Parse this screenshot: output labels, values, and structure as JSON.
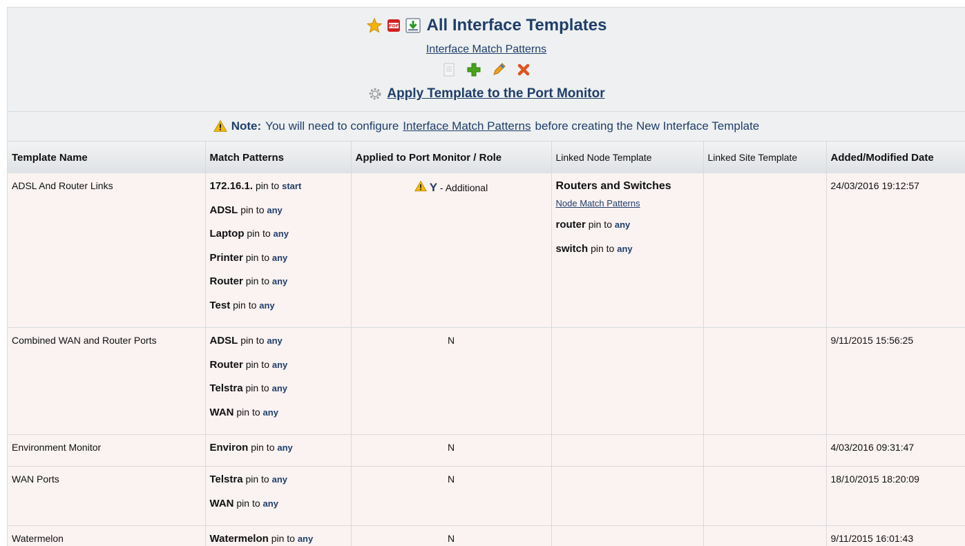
{
  "header": {
    "title": "All Interface Templates",
    "subtitle_link": "Interface Match Patterns",
    "apply_link": "Apply Template to the Port Monitor",
    "icons": [
      "star-icon",
      "pdf-icon",
      "download-icon"
    ],
    "tools": [
      "details-icon",
      "add-icon",
      "edit-icon",
      "delete-icon"
    ]
  },
  "note": {
    "label": "Note:",
    "text_before": "You will need to configure",
    "link": "Interface Match Patterns",
    "text_after": "before creating the New Interface Template"
  },
  "pin_to": "pin to",
  "table": {
    "columns": [
      "Template Name",
      "Match Patterns",
      "Applied to Port Monitor / Role",
      "Linked Node Template",
      "Linked Site Template",
      "Added/Modified Date"
    ],
    "rows": [
      {
        "name": "ADSL And Router Links",
        "patterns": [
          {
            "p": "172.16.1.",
            "k": "start"
          },
          {
            "p": "ADSL",
            "k": "any"
          },
          {
            "p": "Laptop",
            "k": "any"
          },
          {
            "p": "Printer",
            "k": "any"
          },
          {
            "p": "Router",
            "k": "any"
          },
          {
            "p": "Test",
            "k": "any"
          }
        ],
        "applied": "Y",
        "role": "- Additional",
        "node": {
          "title": "Routers and Switches",
          "link": "Node Match Patterns",
          "patterns": [
            {
              "p": "router",
              "k": "any"
            },
            {
              "p": "switch",
              "k": "any"
            }
          ]
        },
        "site": "",
        "date": "24/03/2016 19:12:57"
      },
      {
        "name": "Combined WAN and Router Ports",
        "patterns": [
          {
            "p": "ADSL",
            "k": "any"
          },
          {
            "p": "Router",
            "k": "any"
          },
          {
            "p": "Telstra",
            "k": "any"
          },
          {
            "p": "WAN",
            "k": "any"
          }
        ],
        "applied": "N",
        "site": "",
        "date": "9/11/2015 15:56:25"
      },
      {
        "name": "Environment Monitor",
        "patterns": [
          {
            "p": "Environ",
            "k": "any"
          }
        ],
        "applied": "N",
        "site": "",
        "date": "4/03/2016 09:31:47"
      },
      {
        "name": "WAN Ports",
        "patterns": [
          {
            "p": "Telstra",
            "k": "any"
          },
          {
            "p": "WAN",
            "k": "any"
          }
        ],
        "applied": "N",
        "site": "",
        "date": "18/10/2015 18:20:09"
      },
      {
        "name": "Watermelon",
        "patterns": [
          {
            "p": "Watermelon",
            "k": "any"
          }
        ],
        "applied": "N",
        "site": "",
        "date": "9/11/2015 16:01:43"
      }
    ]
  }
}
